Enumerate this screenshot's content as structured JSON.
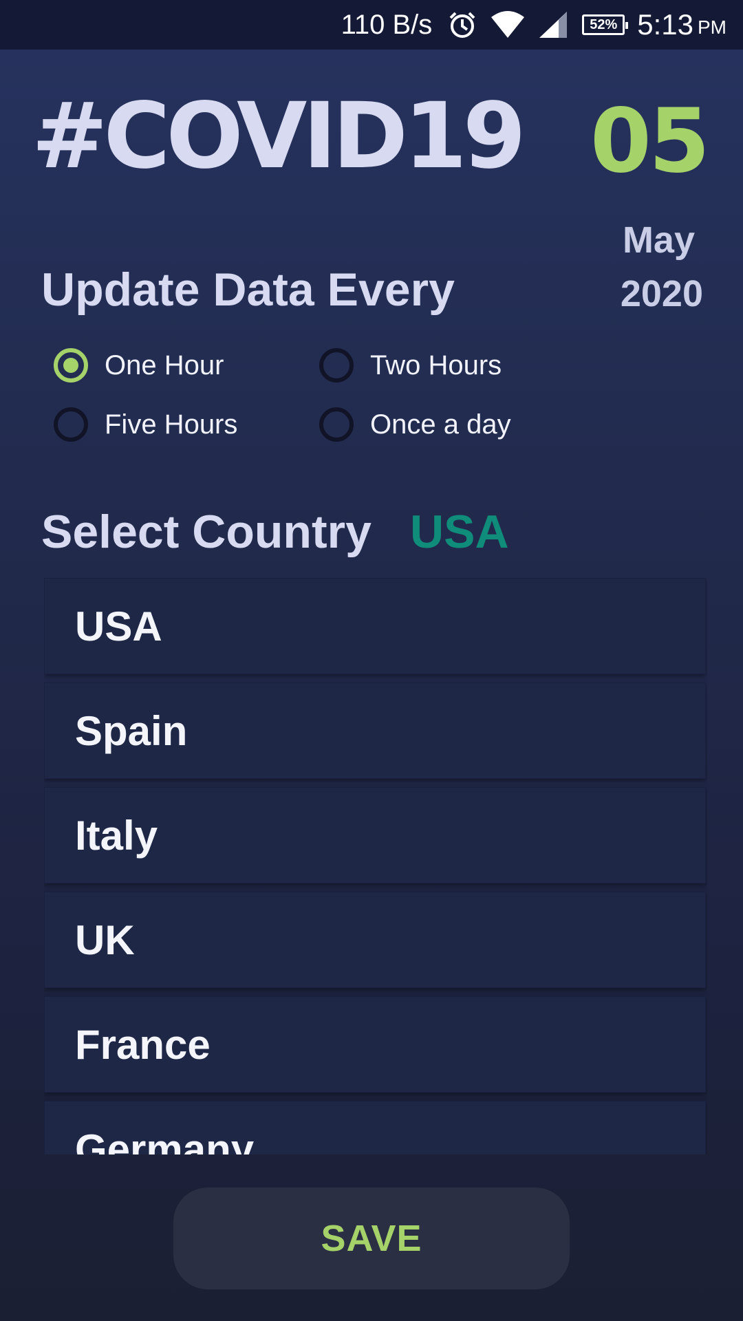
{
  "status_bar": {
    "net_speed": "110 B/s",
    "battery": "52%",
    "time": "5:13",
    "ampm": "PM"
  },
  "header": {
    "title": "#COVID19",
    "day": "05",
    "month": "May",
    "year": "2020"
  },
  "update": {
    "title": "Update Data Every",
    "options": [
      {
        "label": "One Hour",
        "selected": true
      },
      {
        "label": "Two Hours",
        "selected": false
      },
      {
        "label": "Five Hours",
        "selected": false
      },
      {
        "label": "Once a day",
        "selected": false
      }
    ]
  },
  "country": {
    "title": "Select Country",
    "selected": "USA",
    "items": [
      "USA",
      "Spain",
      "Italy",
      "UK",
      "France",
      "Germany"
    ]
  },
  "save_label": "SAVE",
  "colors": {
    "accent_green": "#a6d26a",
    "selected_teal": "#0f8c7a",
    "status_bar": "#141a36"
  }
}
